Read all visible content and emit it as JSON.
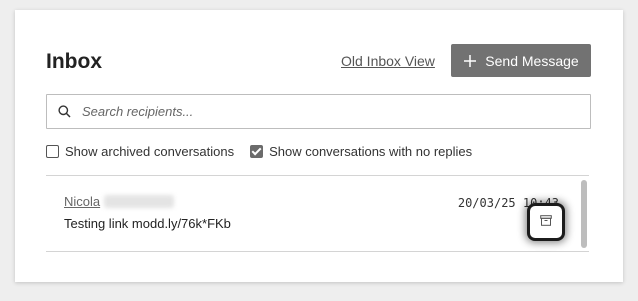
{
  "inbox": {
    "title": "Inbox",
    "old_view_link": "Old Inbox View",
    "send_button": {
      "icon": "plus-icon",
      "label": "Send Message"
    },
    "search": {
      "placeholder": "Search recipients...",
      "value": "",
      "icon": "search-icon"
    },
    "filters": [
      {
        "label": "Show archived conversations",
        "checked": false
      },
      {
        "label": "Show conversations with no replies",
        "checked": true
      }
    ],
    "conversations": [
      {
        "name": "Nicola",
        "preview": "Testing link modd.ly/76k*FKb",
        "timestamp": "20/03/25 10:43",
        "action_icon": "archive-icon"
      }
    ]
  },
  "colors": {
    "accent": "#727272",
    "page_background": "#eeeeee",
    "panel": "#ffffff"
  }
}
